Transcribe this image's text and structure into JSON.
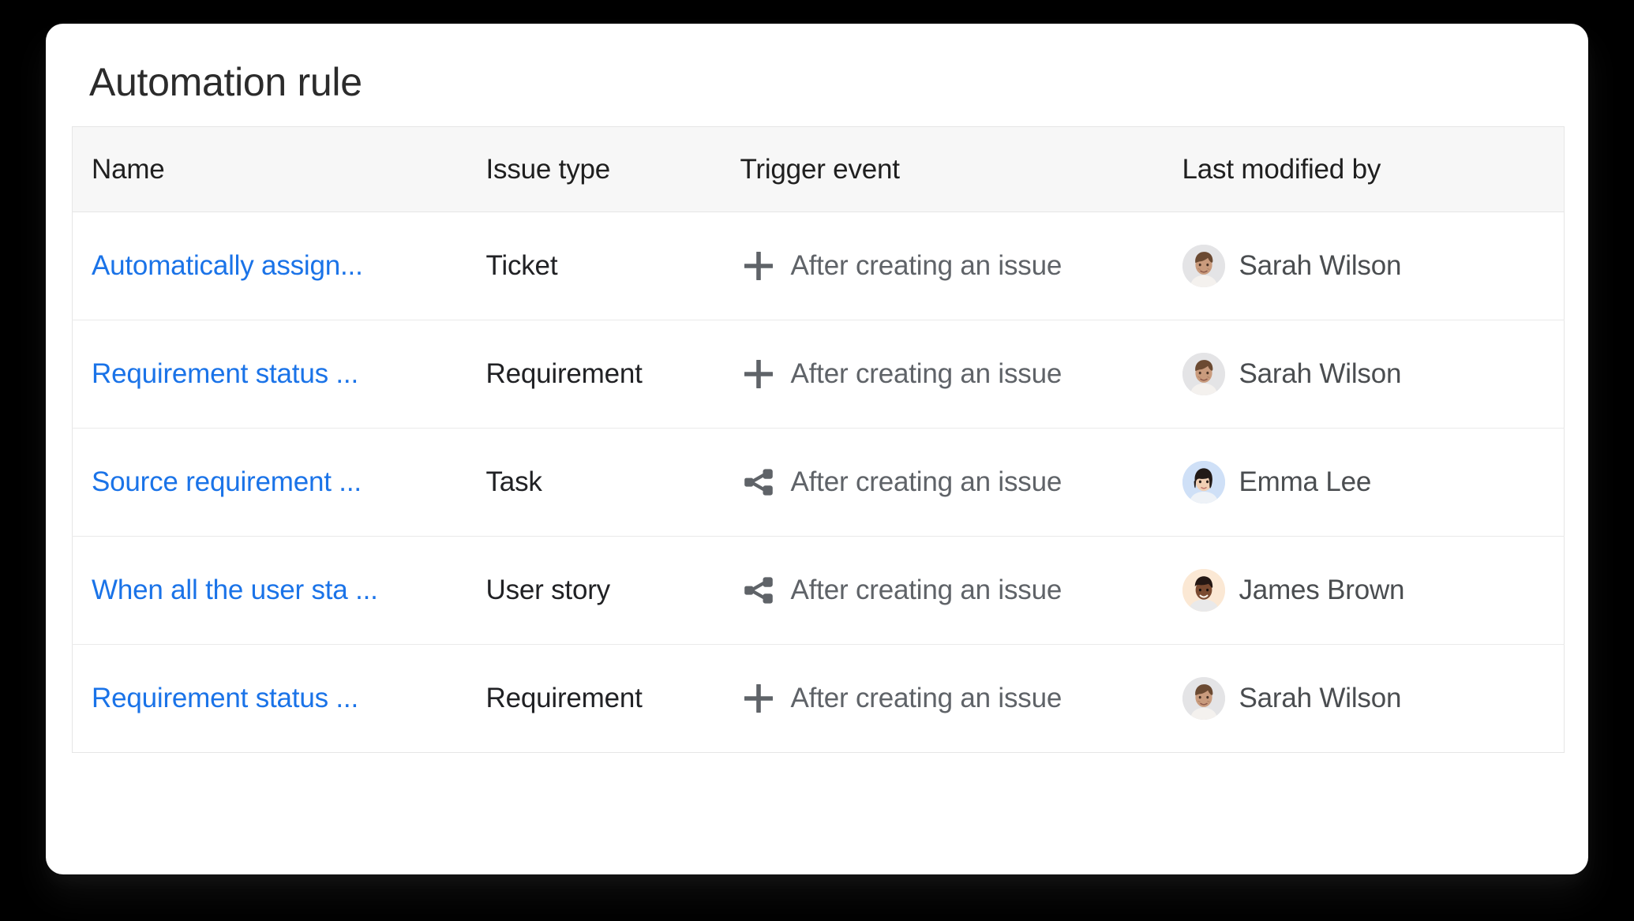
{
  "card": {
    "title": "Automation rule",
    "background": "#ffffff",
    "page_background": "#000000"
  },
  "table": {
    "header_background": "#f7f7f7",
    "border_color": "#e6e6e6",
    "link_color": "#1a73e8",
    "columns": [
      {
        "key": "name",
        "label": "Name"
      },
      {
        "key": "type",
        "label": "Issue type"
      },
      {
        "key": "trigger",
        "label": "Trigger event"
      },
      {
        "key": "user",
        "label": "Last modified by"
      }
    ],
    "rows": [
      {
        "name": "Automatically assign...",
        "issue_type": "Ticket",
        "trigger_icon": "plus-icon",
        "trigger_event": "After creating an issue",
        "user": "Sarah Wilson",
        "avatar_icon": "avatar-sarah-wilson",
        "avatar_bg": "#e4e4e6"
      },
      {
        "name": "Requirement status ...",
        "issue_type": "Requirement",
        "trigger_icon": "plus-icon",
        "trigger_event": "After creating an issue",
        "user": "Sarah Wilson",
        "avatar_icon": "avatar-sarah-wilson",
        "avatar_bg": "#e4e4e6"
      },
      {
        "name": "Source requirement ...",
        "issue_type": "Task",
        "trigger_icon": "share-branch-icon",
        "trigger_event": "After creating an issue",
        "user": "Emma Lee",
        "avatar_icon": "avatar-emma-lee",
        "avatar_bg": "#cfe0f7"
      },
      {
        "name": "When all the user sta ...",
        "issue_type": "User story",
        "trigger_icon": "share-branch-icon",
        "trigger_event": "After creating an issue",
        "user": "James Brown",
        "avatar_icon": "avatar-james-brown",
        "avatar_bg": "#fbe8d4"
      },
      {
        "name": "Requirement status ...",
        "issue_type": "Requirement",
        "trigger_icon": "plus-icon",
        "trigger_event": "After creating an issue",
        "user": "Sarah Wilson",
        "avatar_icon": "avatar-sarah-wilson",
        "avatar_bg": "#e4e4e6"
      }
    ]
  }
}
